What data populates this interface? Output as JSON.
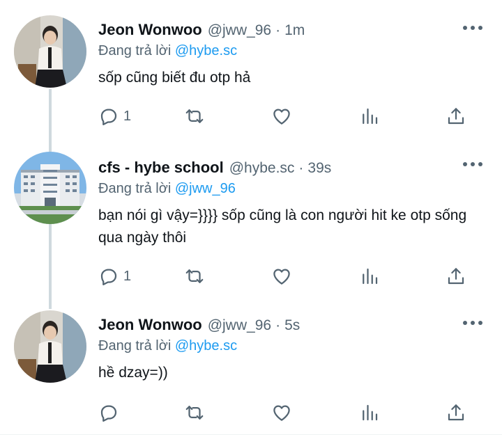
{
  "tweets": [
    {
      "name": "Jeon Wonwoo",
      "handle": "@jww_96",
      "time": "1m",
      "reply_prefix": "Đang trả lời",
      "reply_to": "@hybe.sc",
      "text": "sốp cũng biết đu otp hả",
      "reply_count": "1"
    },
    {
      "name": "cfs - hybe school",
      "handle": "@hybe.sc",
      "time": "39s",
      "reply_prefix": "Đang trả lời",
      "reply_to": "@jww_96",
      "text": "bạn nói gì vậy=}}}} sốp cũng là con người hit ke otp sống qua ngày thôi",
      "reply_count": "1"
    },
    {
      "name": "Jeon Wonwoo",
      "handle": "@jww_96",
      "time": "5s",
      "reply_prefix": "Đang trả lời",
      "reply_to": "@hybe.sc",
      "text": "hề dzay=))",
      "reply_count": ""
    }
  ],
  "separator": "·",
  "colors": {
    "accent": "#1d9bf0",
    "secondary": "#536471",
    "thread_line": "#cfd9de"
  },
  "icons": [
    "reply-icon",
    "retweet-icon",
    "like-icon",
    "analytics-icon",
    "share-icon",
    "more-icon"
  ]
}
